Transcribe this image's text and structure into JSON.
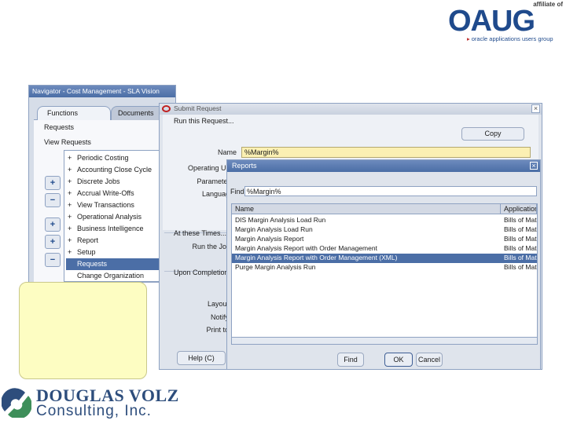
{
  "oaug": {
    "affiliate": "affiliate of",
    "logo": "OAUG",
    "tagline": "oracle applications users group"
  },
  "navigator": {
    "title": "Navigator - Cost Management - SLA Vision",
    "tabs": [
      "Functions",
      "Documents"
    ],
    "links": [
      "Requests",
      "View Requests"
    ],
    "tree": [
      {
        "prefix": "+",
        "label": "Periodic Costing"
      },
      {
        "prefix": "+",
        "label": "Accounting Close Cycle"
      },
      {
        "prefix": "+",
        "label": "Discrete Jobs"
      },
      {
        "prefix": "+",
        "label": "Accrual Write-Offs"
      },
      {
        "prefix": "+",
        "label": "View Transactions"
      },
      {
        "prefix": "+",
        "label": "Operational Analysis"
      },
      {
        "prefix": "+",
        "label": "Business Intelligence"
      },
      {
        "prefix": "+",
        "label": "Report"
      },
      {
        "prefix": "+",
        "label": "Setup"
      },
      {
        "prefix": "",
        "label": "Requests",
        "selected": true
      },
      {
        "prefix": "",
        "label": "Change Organization"
      }
    ],
    "buttons": [
      "+",
      "−",
      "+",
      "+",
      "−"
    ]
  },
  "submit_request": {
    "title": "Submit Request",
    "run_this_request": "Run this Request...",
    "copy_label": "Copy",
    "name_label": "Name",
    "name_value": "%Margin%",
    "operating_unit_label": "Operating Unit",
    "parameters_label": "Parameters",
    "language_label": "Language",
    "at_these_times_label": "At these Times...",
    "run_the_job_label": "Run the Job",
    "upon_completion_label": "Upon Completion...",
    "layout_label": "Layout",
    "notify_label": "Notify",
    "print_to_label": "Print to",
    "help_label": "Help (C)"
  },
  "reports_dialog": {
    "title": "Reports",
    "find_label": "Find",
    "find_value": "%Margin%",
    "columns": [
      "Name",
      "Application"
    ],
    "rows": [
      {
        "name": "DIS Margin Analysis Load Run",
        "app": "Bills of Mat"
      },
      {
        "name": "Margin Analysis Load Run",
        "app": "Bills of Mat"
      },
      {
        "name": "Margin Analysis Report",
        "app": "Bills of Mat"
      },
      {
        "name": "Margin Analysis Report with Order Management",
        "app": "Bills of Mat"
      },
      {
        "name": "Margin Analysis Report with Order Management (XML)",
        "app": "Bills of Mat",
        "selected": true
      },
      {
        "name": "Purge Margin Analysis Run",
        "app": "Bills of Mat"
      }
    ],
    "find_button": "Find",
    "ok_button": "OK",
    "cancel_button": "Cancel"
  },
  "douglas_volz": {
    "line1": "DOUGLAS VOLZ",
    "line2": "Consulting, Inc."
  },
  "colors": {
    "title_blue": "#4b6ea6",
    "highlight_yellow": "#fbf0b3",
    "note_yellow": "#fdfdc2",
    "logo_blue": "#1f4a8c"
  }
}
